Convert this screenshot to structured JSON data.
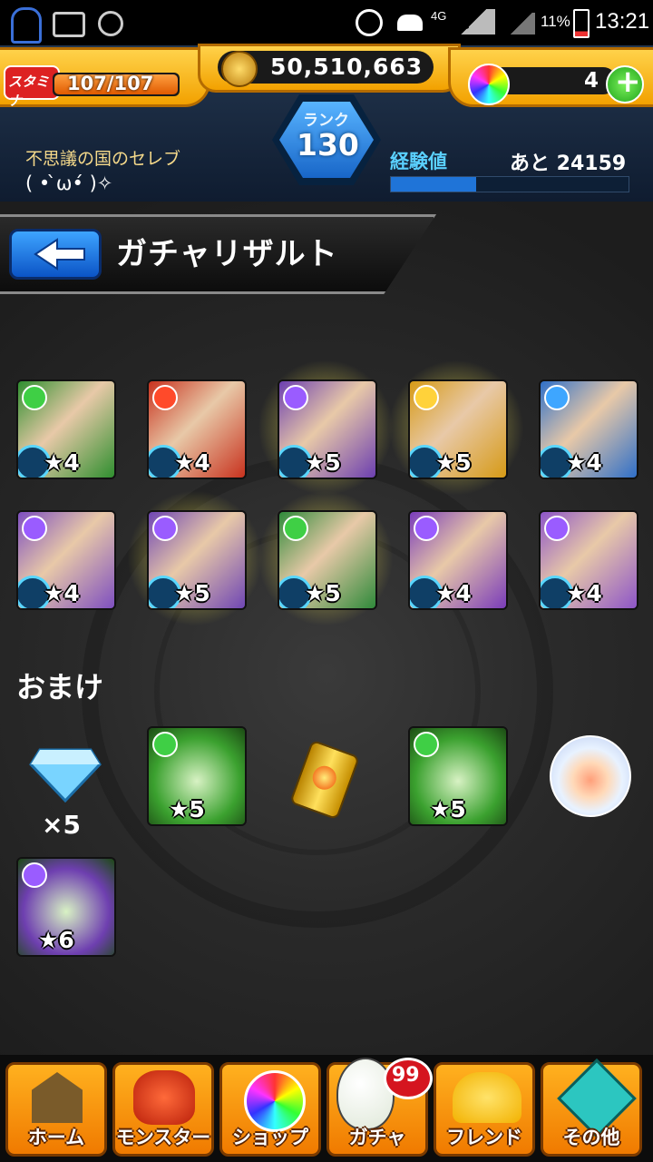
{
  "status_bar": {
    "network": "4G",
    "network2": "4G",
    "battery": "11%",
    "time": "13:21"
  },
  "header": {
    "stamina_label": "スタミナ",
    "stamina_value": "107/107",
    "coins": "50,510,663",
    "orbs": "4",
    "rank_label": "ランク",
    "rank_value": "130",
    "player_title": "不思議の国のセレブ",
    "player_name": "( • ̀ω•́ )✧",
    "exp_label": "経験値",
    "exp_remaining": "あと 24159",
    "exp_progress": 0.36
  },
  "page": {
    "title": "ガチャリザルト"
  },
  "results": [
    {
      "stars": "★4",
      "attr": "wood",
      "color": "#2f8f2f",
      "glow": false
    },
    {
      "stars": "★4",
      "attr": "fire",
      "color": "#c8321e",
      "glow": false
    },
    {
      "stars": "★5",
      "attr": "dark",
      "color": "#6c3fb0",
      "glow": true
    },
    {
      "stars": "★5",
      "attr": "light",
      "color": "#d69a16",
      "glow": true
    },
    {
      "stars": "★4",
      "attr": "water",
      "color": "#2f6fc8",
      "glow": false
    },
    {
      "stars": "★4",
      "attr": "dark",
      "color": "#7e4fc0",
      "glow": false
    },
    {
      "stars": "★5",
      "attr": "dark",
      "color": "#6f46b4",
      "glow": true
    },
    {
      "stars": "★5",
      "attr": "wood",
      "color": "#2f8a3a",
      "glow": true
    },
    {
      "stars": "★4",
      "attr": "dark",
      "color": "#7a3cba",
      "glow": false
    },
    {
      "stars": "★4",
      "attr": "dark",
      "color": "#8d55c8",
      "glow": false
    }
  ],
  "bonus": {
    "label": "おまけ",
    "gem_count": "×5",
    "items": [
      {
        "stars": "★5",
        "color": "#3ba12f"
      },
      {
        "stars": "★5",
        "color": "#3ba12f"
      },
      {
        "stars": "★6",
        "color": "#6e3fb0"
      }
    ]
  },
  "footer": {
    "home": "ホーム",
    "monster": "モンスター",
    "shop": "ショップ",
    "gacha": "ガチャ",
    "gacha_badge": "99",
    "friend": "フレンド",
    "other": "その他"
  },
  "colors": {
    "gold": "#f5a800",
    "exp_bar": "#1f74d8",
    "rank": "#2d8bf0"
  }
}
